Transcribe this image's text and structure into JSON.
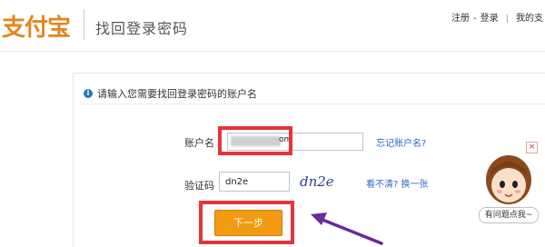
{
  "header": {
    "logo_text": "支付宝",
    "title": "找回登录密码",
    "links": [
      "注册",
      "-",
      "登录",
      "|",
      "我的支"
    ]
  },
  "form": {
    "instruction": "请输入您需要找回登录密码的账户名",
    "account_label": "账户名",
    "account_value_suffix": "om",
    "forgot_link": "忘记账户名?",
    "captcha_label": "验证码",
    "captcha_value": "dn2e",
    "captcha_image_text": "dn2e",
    "unclear_link": "看不清? 换一张",
    "next_button": "下一步"
  },
  "helper": {
    "bubble_text": "有问题点我~",
    "close": "×"
  },
  "colors": {
    "brand_orange": "#e5851e",
    "button_orange": "#f29a14",
    "link_blue": "#2e6bc3",
    "annotation_red": "#e8333a",
    "arrow_purple": "#6a2a9a"
  },
  "icons": {
    "info": "info-icon"
  }
}
